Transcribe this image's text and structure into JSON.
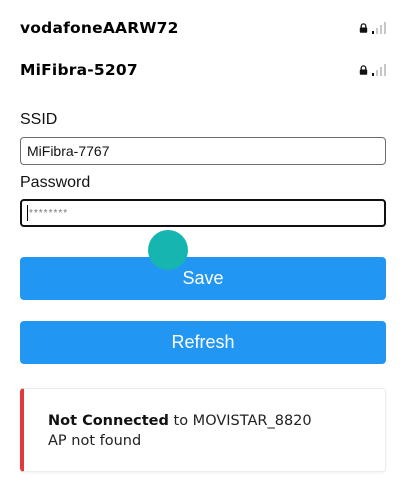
{
  "networks": [
    {
      "ssid": "vodafoneAARW72",
      "locked_icon": "lock-icon",
      "signal_icon": "signal-weak-icon"
    },
    {
      "ssid": "MiFibra-5207",
      "locked_icon": "lock-icon",
      "signal_icon": "signal-weak-icon"
    }
  ],
  "form": {
    "ssid_label": "SSID",
    "ssid_value": "MiFibra-7767",
    "password_label": "Password",
    "password_value": "********"
  },
  "buttons": {
    "save_label": "Save",
    "refresh_label": "Refresh"
  },
  "status": {
    "state": "Not Connected",
    "to_text": " to MOVISTAR_8820",
    "detail": "AP not found",
    "accent_color": "#e0393e"
  },
  "colors": {
    "button": "#2196f3",
    "touch_indicator": "#17b5b0"
  }
}
